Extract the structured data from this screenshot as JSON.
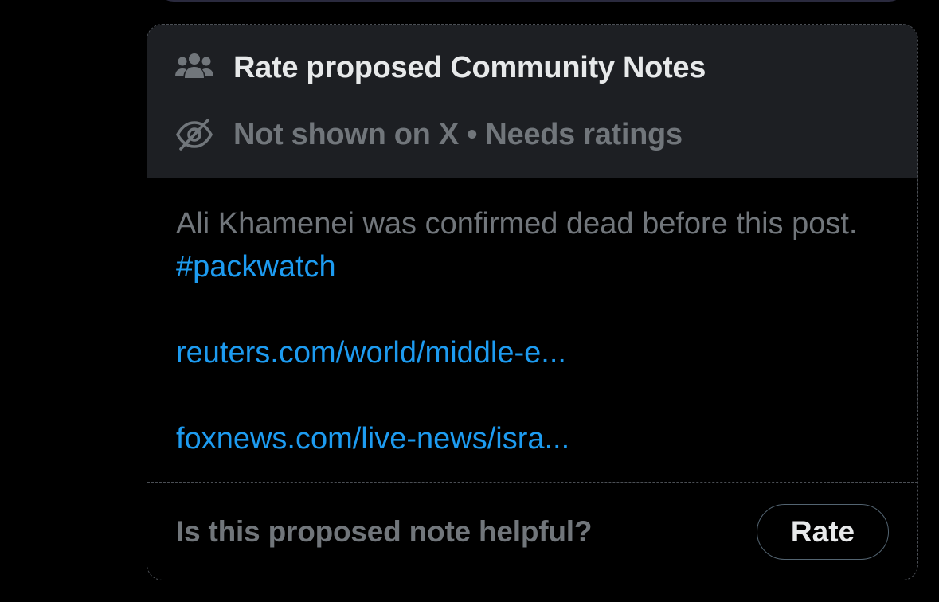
{
  "note": {
    "header": {
      "title": "Rate proposed Community Notes",
      "title_icon": "community-people-icon",
      "status": "Not shown on X • Needs ratings",
      "status_icon": "eye-slash-icon"
    },
    "body": {
      "text": "Ali Khamenei was confirmed dead before this post. ",
      "hashtag": "#packwatch",
      "links": [
        "reuters.com/world/middle-e...",
        "foxnews.com/live-news/isra..."
      ]
    },
    "footer": {
      "question": "Is this proposed note helpful?",
      "rate_label": "Rate"
    }
  },
  "colors": {
    "background": "#000000",
    "header_background": "#1d1f23",
    "primary_text": "#e7e9ea",
    "secondary_text": "#71767b",
    "link": "#1d9bf0",
    "dashed_border": "#4a4e54"
  }
}
